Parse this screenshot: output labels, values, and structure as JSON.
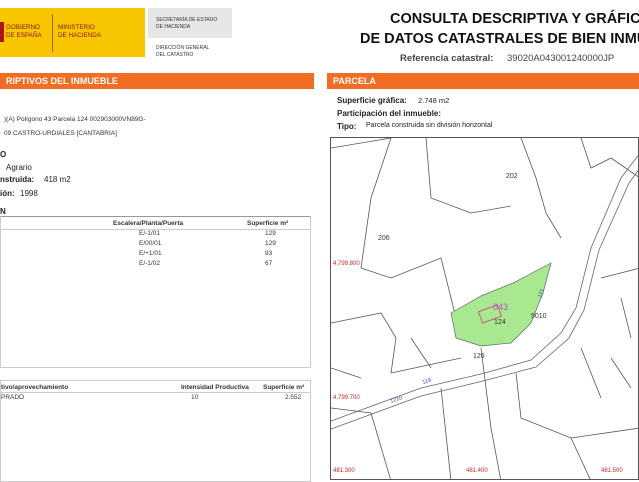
{
  "header": {
    "ministry_logo": [
      "GOBIERNO",
      "DE ESPAÑA"
    ],
    "ministry_name": [
      "MINISTERIO",
      "DE HACIENDA"
    ],
    "secretariat": [
      "SECRETARÍA DE ESTADO",
      "DE HACIENDA"
    ],
    "direction": [
      "DIRECCIÓN GENERAL",
      "DEL CATASTRO"
    ],
    "title_line1": "CONSULTA DESCRIPTIVA Y GRÁFICA",
    "title_line2": "DE DATOS CATASTRALES DE BIEN INMU",
    "ref_label": "Referencia catastral:",
    "ref_value": "39020A043001240000JP"
  },
  "left": {
    "section_title": "RIPTIVOS DEL INMUEBLE",
    "location_line1": ")(A) Polígono 43 Parcela 124 002903000VN89G-",
    "location_line2": "09 CASTRO-URDIALES [CANTABRIA]",
    "o_label": "O",
    "use_value": "Agrario",
    "built_label": "nstruida:",
    "built_value": "418 m2",
    "year_label": "ión:",
    "year_value": "1998",
    "construction_title": "N",
    "constructions": {
      "headers": [
        "Escalera/Planta/Puerta",
        "Superficie m²"
      ],
      "rows": [
        [
          "E/-1/01",
          "129"
        ],
        [
          "E/00/01",
          "129"
        ],
        [
          "E/+1/01",
          "93"
        ],
        [
          "E/-1/02",
          "67"
        ]
      ]
    },
    "crops": {
      "headers": [
        "tivo/aprovechamiento",
        "Intensidad Productiva",
        "Superficie m²"
      ],
      "rows": [
        [
          "PRADO",
          "10",
          "2.552"
        ]
      ]
    }
  },
  "right": {
    "section_title": "PARCELA",
    "surface_label": "Superficie gráfica:",
    "surface_value": "2.748 m2",
    "participation_label": "Participación del inmueble:",
    "type_label": "Tipo:",
    "type_value": "Parcela construida sin división horizontal"
  },
  "map": {
    "parcels": [
      "202",
      "206",
      "124",
      "126",
      "9010",
      "043"
    ],
    "coord_left": [
      "4.799.800",
      "4.799.700"
    ],
    "coord_bottom": [
      "481.300",
      "481.400",
      "481.500"
    ],
    "road_labels": [
      "1210",
      "119",
      "121"
    ],
    "colors": {
      "parcel_fill": "#a8e890",
      "coord": "#cc2222",
      "road_label": "#3344aa",
      "parcel_id": "#b050d0"
    }
  }
}
